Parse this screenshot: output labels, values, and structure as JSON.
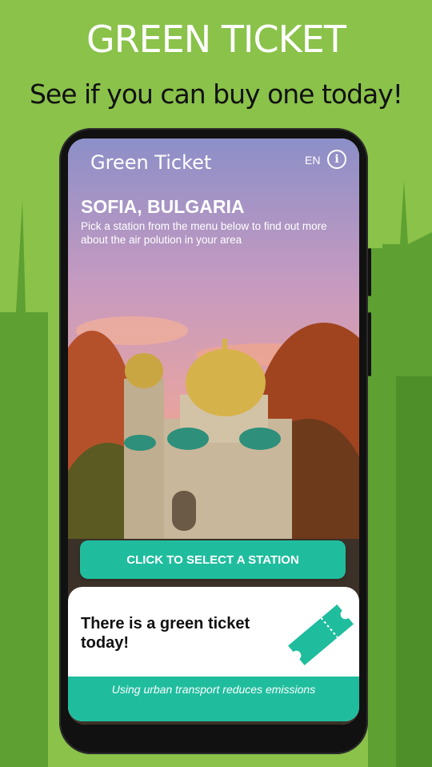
{
  "promo": {
    "title": "GREEN TICKET",
    "subtitle": "See if you can buy one today!"
  },
  "app": {
    "logo_text": "Green Ticket",
    "language": "EN",
    "info_icon": "info-icon",
    "city": "SOFIA, BULGARIA",
    "instructions": "Pick a station from the menu below to find out more about the air polution in your area",
    "select_button": "CLICK TO SELECT A STATION",
    "status_message": "There is a green ticket today!",
    "footer_text": "Using urban transport reduces emissions"
  },
  "colors": {
    "background": "#8ac24a",
    "accent": "#1fbd9e",
    "phone": "#111111"
  }
}
